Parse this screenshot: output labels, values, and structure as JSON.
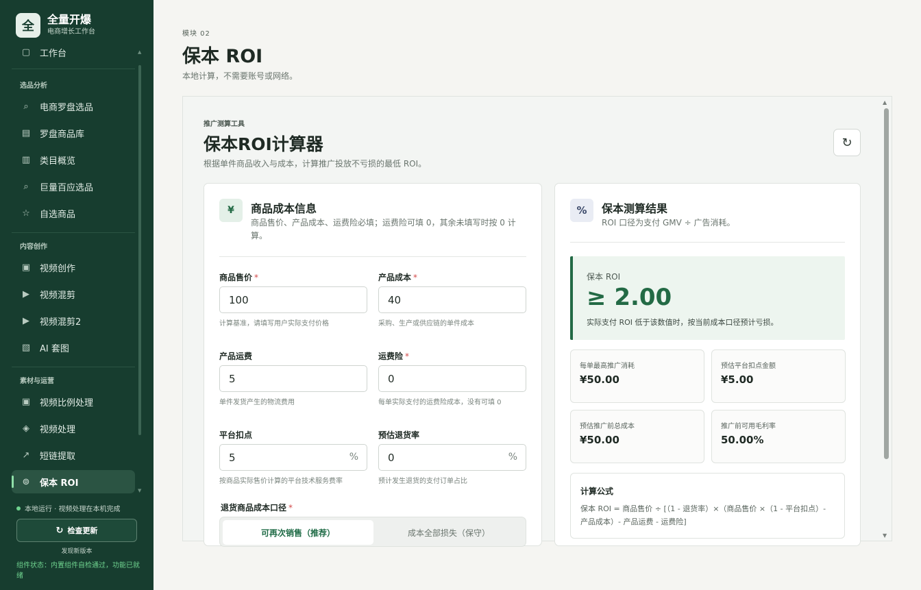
{
  "sidebar": {
    "brand": {
      "logo": "全",
      "name": "全量开爆",
      "subtitle": "电商增长工作台"
    },
    "items": [
      {
        "label": "工作台",
        "icon": "workspace-icon",
        "glyph": "▢"
      },
      {
        "label": "电商罗盘选品",
        "icon": "search-icon",
        "glyph": "⌕"
      },
      {
        "label": "罗盘商品库",
        "icon": "list-icon",
        "glyph": "▤"
      },
      {
        "label": "类目概览",
        "icon": "grid-icon",
        "glyph": "▥"
      },
      {
        "label": "巨量百应选品",
        "icon": "search-icon",
        "glyph": "⌕"
      },
      {
        "label": "自选商品",
        "icon": "star-icon",
        "glyph": "☆"
      },
      {
        "label": "视频创作",
        "icon": "video-icon",
        "glyph": "▣"
      },
      {
        "label": "视频混剪",
        "icon": "play-icon",
        "glyph": "▶"
      },
      {
        "label": "视频混剪2",
        "icon": "play-icon",
        "glyph": "▶"
      },
      {
        "label": "AI 套图",
        "icon": "image-icon",
        "glyph": "▧"
      },
      {
        "label": "视频比例处理",
        "icon": "video-icon",
        "glyph": "▣"
      },
      {
        "label": "视频处理",
        "icon": "diamond-icon",
        "glyph": "◈"
      },
      {
        "label": "短链提取",
        "icon": "link-icon",
        "glyph": "↗"
      },
      {
        "label": "保本 ROI",
        "icon": "target-icon",
        "glyph": "⊚"
      }
    ],
    "sections": [
      "选品分析",
      "内容创作",
      "素材与运营"
    ],
    "status": "本地运行 · 视频处理在本机完成",
    "update_button": "检查更新",
    "update_icon": "↻",
    "update_note": "发现新版本",
    "component_status": "组件状态：内置组件自检通过，功能已就绪"
  },
  "page": {
    "module": "模块 02",
    "title": "保本 ROI",
    "description": "本地计算，不需要账号或网络。"
  },
  "tool": {
    "label": "推广测算工具",
    "title": "保本ROI计算器",
    "description": "根据单件商品收入与成本，计算推广投放不亏损的最低 ROI。",
    "reset_icon": "↻"
  },
  "cost_card": {
    "icon": "¥",
    "title": "商品成本信息",
    "subtitle": "商品售价、产品成本、运费险必填；运费险可填 0，其余未填写时按 0 计算。",
    "fields": {
      "price": {
        "label": "商品售价",
        "required": "*",
        "value": "100",
        "hint": "计算基准，请填写用户实际支付价格"
      },
      "cost": {
        "label": "产品成本",
        "required": "*",
        "value": "40",
        "hint": "采购、生产或供应链的单件成本"
      },
      "shipping": {
        "label": "产品运费",
        "value": "5",
        "hint": "单件发货产生的物流费用"
      },
      "insurance": {
        "label": "运费险",
        "required": "*",
        "value": "0",
        "hint": "每单实际支付的运费险成本，没有可填 0"
      },
      "commission": {
        "label": "平台扣点",
        "value": "5",
        "suffix": "%",
        "hint": "按商品实际售价计算的平台技术服务费率"
      },
      "return_rate": {
        "label": "预估退货率",
        "value": "0",
        "suffix": "%",
        "hint": "预计发生退货的支付订单占比"
      }
    },
    "return_cost": {
      "label": "退货商品成本口径",
      "required": "*",
      "options": [
        "可再次销售（推荐）",
        "成本全部损失（保守）"
      ]
    }
  },
  "result_card": {
    "icon": "%",
    "title": "保本测算结果",
    "subtitle": "ROI 口径为支付 GMV ÷ 广告消耗。",
    "roi_label": "保本 ROI",
    "roi_value": "≥ 2.00",
    "roi_note": "实际支付 ROI 低于该数值时，按当前成本口径预计亏损。",
    "metrics": [
      {
        "label": "每单最高推广消耗",
        "value": "¥50.00"
      },
      {
        "label": "预估平台扣点金额",
        "value": "¥5.00"
      },
      {
        "label": "预估推广前总成本",
        "value": "¥50.00"
      },
      {
        "label": "推广前可用毛利率",
        "value": "50.00%"
      }
    ],
    "formula_title": "计算公式",
    "formula": "保本 ROI = 商品售价 ÷ [（1 - 退货率）×（商品售价 ×（1 - 平台扣点）- 产品成本）- 产品运费 - 运费险]"
  }
}
